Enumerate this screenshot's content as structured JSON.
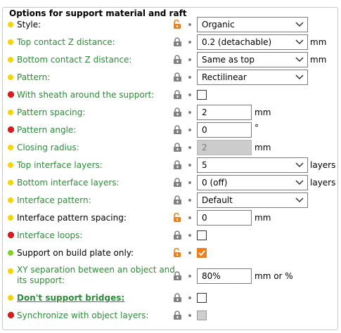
{
  "panel": {
    "title": "Options for support material and raft"
  },
  "rows": [
    {
      "label": "Style:",
      "control": {
        "value": "Organic"
      }
    },
    {
      "label": "Top contact Z distance:",
      "control": {
        "value": "0.2 (detachable)"
      },
      "unit": "mm"
    },
    {
      "label": "Bottom contact Z distance:",
      "control": {
        "value": "Same as top"
      },
      "unit": "mm"
    },
    {
      "label": "Pattern:",
      "control": {
        "value": "Rectilinear"
      }
    },
    {
      "label": "With sheath around the support:",
      "control": {
        "checked": false
      }
    },
    {
      "label": "Pattern spacing:",
      "control": {
        "value": "2"
      },
      "unit": "mm"
    },
    {
      "label": "Pattern angle:",
      "control": {
        "value": "0"
      },
      "unit": "°"
    },
    {
      "label": "Closing radius:",
      "control": {
        "value": "2",
        "disabled": true
      },
      "unit": "mm"
    },
    {
      "label": "Top interface layers:",
      "control": {
        "value": "5"
      },
      "unit": "layers"
    },
    {
      "label": "Bottom interface layers:",
      "control": {
        "value": "0 (off)"
      },
      "unit": "layers"
    },
    {
      "label": "Interface pattern:",
      "control": {
        "value": "Default"
      }
    },
    {
      "label": "Interface pattern spacing:",
      "control": {
        "value": "0"
      },
      "unit": "mm"
    },
    {
      "label": "Interface loops:",
      "control": {
        "checked": false
      }
    },
    {
      "label": "Support on build plate only:",
      "control": {
        "checked": true
      }
    },
    {
      "label_line1": "XY separation between an object and",
      "label_line2": "its support:",
      "control": {
        "value": "80%"
      },
      "unit": "mm or %"
    },
    {
      "label": "Don't support bridges:",
      "control": {
        "checked": false
      }
    },
    {
      "label": "Synchronize with object layers:",
      "control": {
        "checked": false,
        "disabled": true
      }
    }
  ],
  "colors": {
    "simple_dot": "#f5d400",
    "advanced_dot": "#7ed321",
    "expert_hex": "#d91c1c",
    "modified_label": "#2e8b3a",
    "unlocked_icon": "#ef7f1a",
    "locked_icon": "#808080"
  }
}
